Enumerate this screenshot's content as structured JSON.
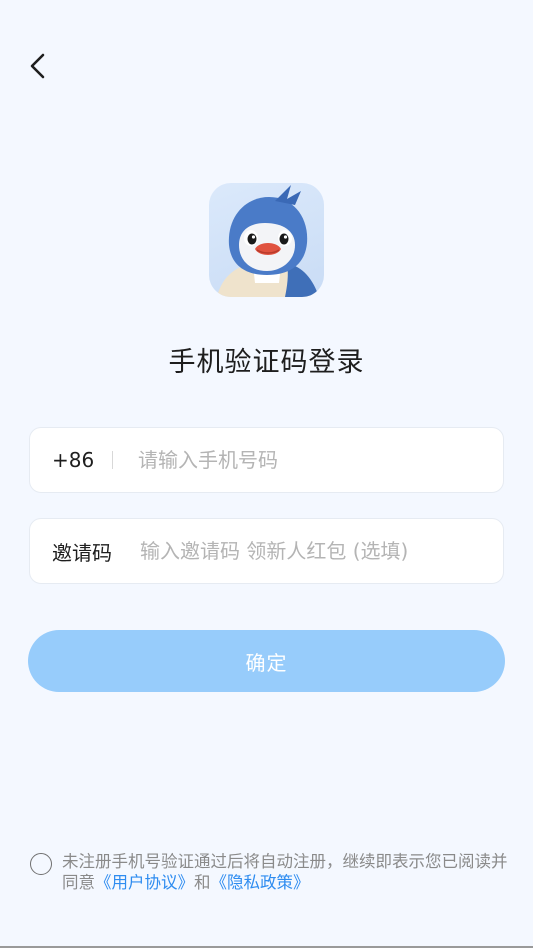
{
  "nav": {
    "back_icon": "chevron-left-icon"
  },
  "logo": {
    "icon": "bird-mascot-avatar"
  },
  "title": "手机验证码登录",
  "phone": {
    "prefix": "+86",
    "placeholder": "请输入手机号码",
    "value": ""
  },
  "invite": {
    "label": "邀请码",
    "placeholder": "输入邀请码 领新人红包 (选填)",
    "value": ""
  },
  "confirm_label": "确定",
  "agreement": {
    "checked": false,
    "text_before": "未注册手机号验证通过后将自动注册，继续即表示您已阅读并同意",
    "user_agreement": "《用户协议》",
    "and": "和",
    "privacy_policy": "《隐私政策》"
  },
  "colors": {
    "background": "#f4f8ff",
    "button": "#97ccfb",
    "link": "#2e8cf0"
  }
}
